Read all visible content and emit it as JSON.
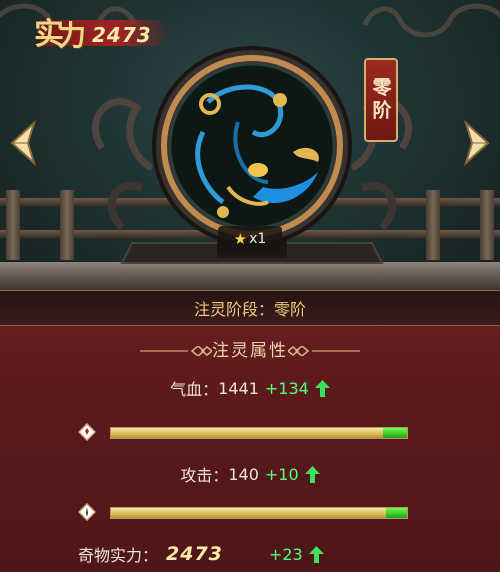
{
  "power": {
    "label_main": "实",
    "label_sub": "力",
    "value": "2473"
  },
  "artifact": {
    "stage_tag": "零阶",
    "star_icon": "star-icon",
    "star_count": "x1"
  },
  "panel": {
    "stage_label": "注灵阶段：零阶",
    "section_title": "注灵属性",
    "hp": {
      "label": "气血：",
      "value": "1441",
      "plus": "+134",
      "bar_level": 0.92
    },
    "attack": {
      "label": "攻击：",
      "value": "140",
      "plus": "+10",
      "bar_level": 0.93
    },
    "artifact_power": {
      "label": "奇物实力：",
      "value": "2473",
      "plus": "+23"
    }
  },
  "colors": {
    "accent_gold": "#f2c77b",
    "plus_green": "#54ff7a",
    "panel_red": "#5a1a1c"
  },
  "icons": [
    "arrow-left-icon",
    "arrow-right-icon",
    "star-icon",
    "up-arrow-icon",
    "hp-diamond-icon",
    "attack-diamond-icon",
    "ornament-icon"
  ]
}
